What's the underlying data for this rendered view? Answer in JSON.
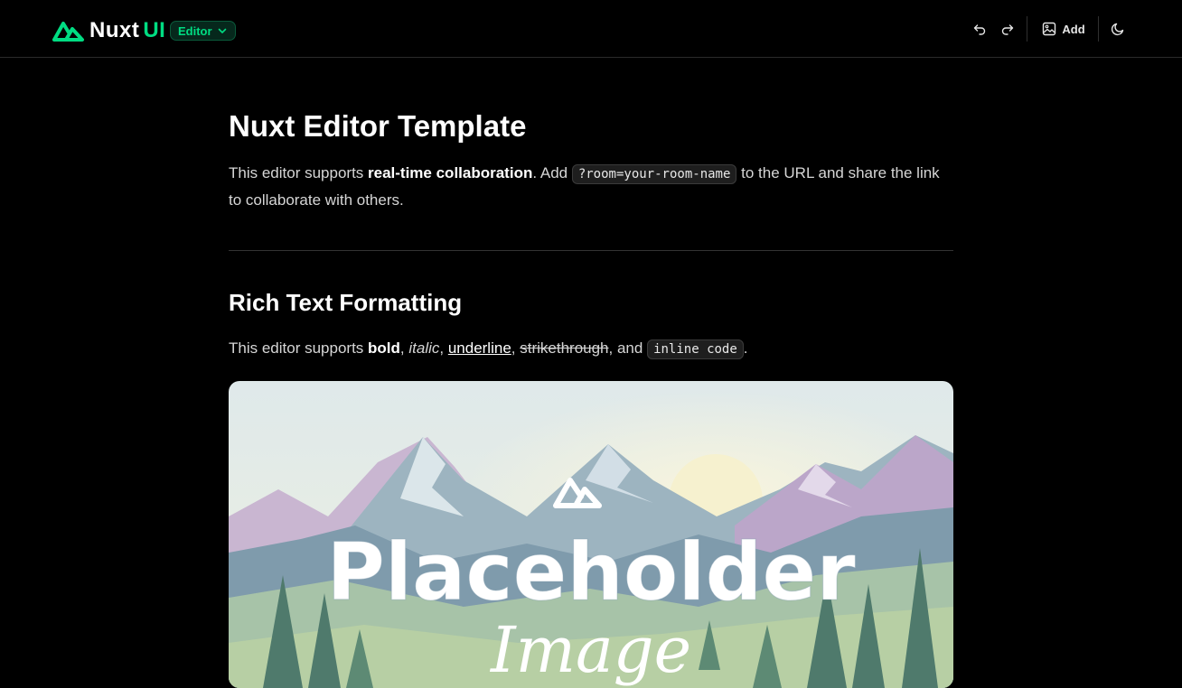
{
  "header": {
    "logo_text": "Nuxt",
    "logo_suffix": "UI",
    "badge_label": "Editor",
    "add_label": "Add"
  },
  "icons": {
    "logo": "nuxt-mountain-icon",
    "badge": "chevron-down-icon",
    "undo": "undo-icon",
    "redo": "redo-icon",
    "add": "image-icon",
    "theme": "moon-icon"
  },
  "colors": {
    "accent": "#00dc82",
    "background": "#000000",
    "text": "#ffffff"
  },
  "document": {
    "title": "Nuxt Editor Template",
    "intro": {
      "t1": "This editor supports ",
      "bold": "real-time collaboration",
      "t2": ". Add ",
      "code": "?room=your-room-name",
      "t3": " to the URL and share the link to collaborate with others."
    },
    "section_title": "Rich Text Formatting",
    "formatting": {
      "t1": "This editor supports ",
      "bold": "bold",
      "c1": ", ",
      "italic": "italic",
      "c2": ", ",
      "underline": "underline",
      "c3": ", ",
      "strike": "strikethrough",
      "c4": ", and ",
      "code": "inline code",
      "end": "."
    },
    "image": {
      "line1": "Placeholder",
      "line2": "Image"
    }
  }
}
